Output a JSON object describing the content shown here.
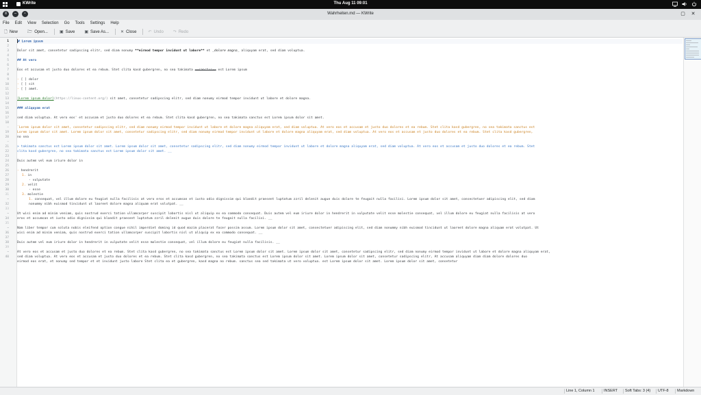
{
  "topbar": {
    "app_name": "KWrite",
    "clock": "Thu Aug 11  09:01"
  },
  "window": {
    "title": "Wahrheiten.md — KWrite"
  },
  "menu": [
    "File",
    "Edit",
    "View",
    "Selection",
    "Go",
    "Tools",
    "Settings",
    "Help"
  ],
  "toolbar": {
    "new": "New",
    "open": "Open...",
    "save": "Save",
    "save_as": "Save As...",
    "close": "Close",
    "undo": "Undo",
    "redo": "Redo"
  },
  "editor": {
    "line_numbers": [
      "1",
      "2",
      "3",
      "4",
      "5",
      "6",
      "7",
      "8",
      "9",
      "10",
      "11",
      "12",
      "13",
      "14",
      "15",
      "16",
      "17",
      "18",
      "~",
      "19",
      "20",
      "~",
      "21",
      "22",
      "23",
      "24",
      "25",
      "26",
      "27",
      "28",
      "29",
      "30",
      "31",
      "~",
      "32",
      "33",
      "~",
      "34",
      "35",
      "~",
      "36",
      "37",
      "38",
      "39",
      "~",
      "40"
    ],
    "lines": {
      "l1": "# Lorem ipsum",
      "l3a": "Dolor sit amet, consetetur sadipscing elitr, sed diam nonumy ",
      "l3b": "**eirmod tempor invidunt ut labore**",
      "l3c": " et ",
      "l3d": "_dolore magna_",
      "l3e": " aliquyam erat, sed diam voluptua.",
      "l5": "## At vero",
      "l7a": "Eos et accusam et justo duo dolores et ea rebum. Stet clita kasd gubergren, no sea takimata ",
      "l7b": "~~sanctus~~",
      "l7c": " est Lorem ipsum",
      "l9a": "- ",
      "l9b": "[ ] dolor",
      "l10b": "[ ] sit",
      "l11b": "[ ] amet.",
      "l13a": "[Lorem ipsum dolor]",
      "l13b": "(https://linux-content.org/)",
      "l13c": " sit amet, consetetur sadipscing elitr, sed diam nonumy eirmod tempor invidunt ut labore et dolore magna.",
      "l15": "### aliquyam erat",
      "l17": "sed diam voluptua. At vero eos' et accusam et justo duo dolores et ea rebum. Stet clita kasd gubergren, no sea takimata sanctus est Lorem ipsum dolor sit amet.",
      "l19a": "`Lorem ipsum dolor sit amet, consetetur sadipscing elitr, sed diam nonumy eirmod tempor invidunt ut labore et dolore magna aliquyam erat, sed diam voluptua. At vero eos et accusam et justo duo dolores et ea rebum. Stet clita kasd gubergren, no sea takimata sanctus est",
      "l19b": "Lorem ipsum dolor sit amet. Lorem ipsum dolor sit amet, consetetur sadipscing elitr, sed diam nonumy eirmod tempor invidunt ut labore et dolore magna aliquyam erat, sed diam voluptua. At vero eos et accusam et justo duo dolores et ea rebum. Stet clita kasd gubergren,",
      "l19c": "no sea",
      "l21a": "> takimata sanctus est Lorem ipsum dolor sit amet. Lorem ipsum dolor sit amet, consetetur sadipscing elitr, sed diam nonumy eirmod tempor invidunt ut labore et dolore magna aliquyam erat, sed diam voluptua. At vero eos et accusam et justo duo dolores et ea rebum. Stet",
      "l21b": "clita kasd gubergren, no sea takimata sanctus est Lorem ipsum dolor sit amet. __",
      "l23": "Duis autem vel eum iriure dolor in",
      "l25a": "- ",
      "l25b": "hendrerit",
      "l26a": "1.",
      "l26b": " in",
      "l27": "- vulputate",
      "l28a": "2.",
      "l28b": " velit",
      "l29": "- esse",
      "l30a": "3.",
      "l30b": " molestie",
      "l31a": "1.",
      "l31b": " consequat, vel illum dolore eu feugiat nulla facilisis at vero eros et accumsan et iusto odio dignissim qui blandit praesent luptatum zzril delenit augue duis dolore te feugait nulla facilisi. Lorem ipsum dolor sit amet, consectetuer adipiscing elit, sed diam",
      "l31c": "nonummy nibh euismod tincidunt ut laoreet dolore magna aliquam erat volutpat. __",
      "l33a": "Ut wisi enim ad minim veniam, quis nostrud exerci tation ullamcorper suscipit lobortis nisl ut aliquip ex ea commodo consequat. Duis autem vel eum iriure dolor in hendrerit in vulputate velit esse molestie consequat, vel illum dolore eu feugiat nulla facilisis at vero",
      "l33b": "eros et accumsan et iusto odio dignissim qui blandit praesent luptatum zzril delenit augue duis dolore te feugait nulla facilisi. __",
      "l35a": "Nam liber tempor cum soluta nobis eleifend option congue nihil imperdiet doming id quod mazim placerat facer possim assum. Lorem ipsum dolor sit amet, consectetuer adipiscing elit, sed diam nonummy nibh euismod tincidunt ut laoreet dolore magna aliquam erat volutpat. Ut",
      "l35b": "wisi enim ad minim veniam, quis nostrud exerci tation ullamcorper suscipit lobortis nisl ut aliquip ex ea commodo consequat. __",
      "l37": "Duis autem vel eum iriure dolor in hendrerit in vulputate velit esse molestie consequat, vel illum dolore eu feugiat nulla facilisis. __",
      "l39a": "At vero eos et accusam et justo duo dolores et ea rebum. Stet clita kasd gubergren, no sea takimata sanctus est Lorem ipsum dolor sit amet. Lorem ipsum dolor sit amet, consetetur sadipscing elitr, sed diam nonumy eirmod tempor invidunt ut labore et dolore magna aliquyam erat,",
      "l39b": "sed diam voluptua. At vero eos et accusam et justo duo dolores et ea rebum. Stet clita kasd gubergren, no sea takimata sanctus est Lorem ipsum dolor sit amet. Lorem ipsum dolor sit amet, consetetur sadipscing elitr, At accusam aliquyam diam diam dolore dolores duo",
      "l39c": "eirmod eos erat, et nonumy sed tempor et et invidunt justo labore Stet clita ea et gubergren, kasd magna no rebum. sanctus sea sed takimata ut vero voluptua. est Lorem ipsum dolor sit amet. Lorem ipsum dolor sit amet, consetetur"
    }
  },
  "status": {
    "position": "Line 1, Column 1",
    "mode": "INSERT",
    "indent": "Soft Tabs: 3 (4)",
    "encoding": "UTF-8",
    "syntax": "Markdown"
  },
  "colors": {
    "heading": "#2c5fa8",
    "list_marker": "#e0831e",
    "link_text": "#2a7a2a",
    "code": "#c97f1d",
    "quote": "#3877c6"
  }
}
